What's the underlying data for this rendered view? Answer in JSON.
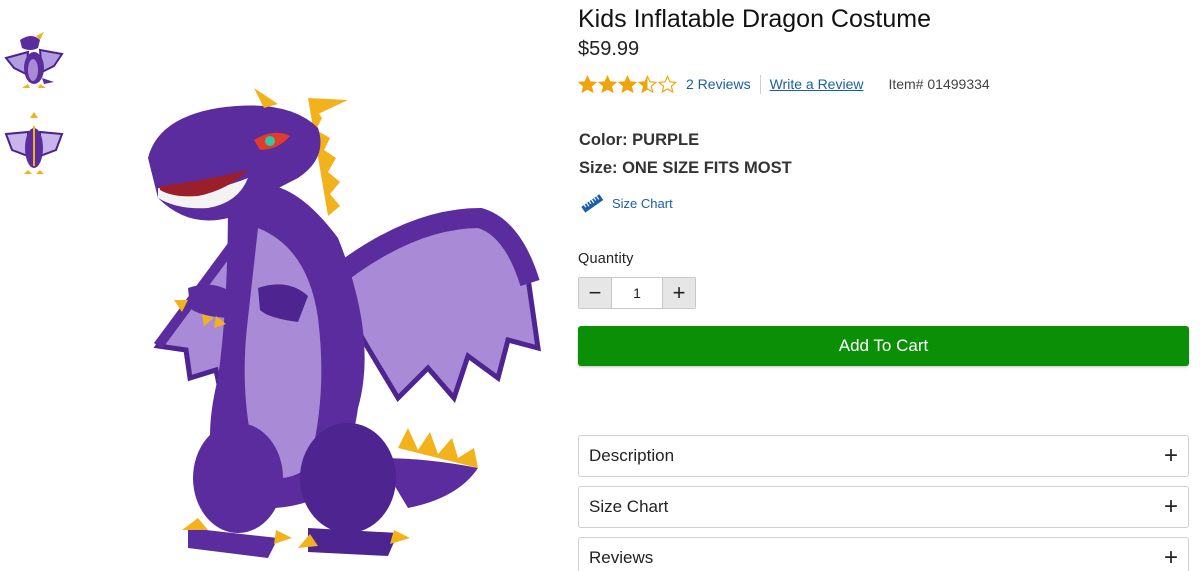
{
  "product": {
    "title": "Kids Inflatable Dragon Costume",
    "price": "$59.99",
    "rating": 3.5,
    "rating_max": 5,
    "reviews_label": "2 Reviews",
    "write_review_label": "Write a Review",
    "item_number": "Item# 01499334",
    "color_label": "Color: PURPLE",
    "size_label": "Size: ONE SIZE FITS MOST",
    "size_chart_label": "Size Chart"
  },
  "quantity": {
    "label": "Quantity",
    "value": "1",
    "minus": "−",
    "plus": "+"
  },
  "cart": {
    "add_label": "Add To Cart"
  },
  "accordions": [
    {
      "title": "Description",
      "icon": "+"
    },
    {
      "title": "Size Chart",
      "icon": "+"
    },
    {
      "title": "Reviews",
      "icon": "+"
    }
  ],
  "colors": {
    "star": "#f0a30a",
    "link": "#1a5ea8",
    "add_to_cart": "#0b8f06",
    "dragon_body": "#5a2c9e",
    "dragon_belly": "#a98ad6",
    "dragon_spikes": "#f2b21b"
  }
}
